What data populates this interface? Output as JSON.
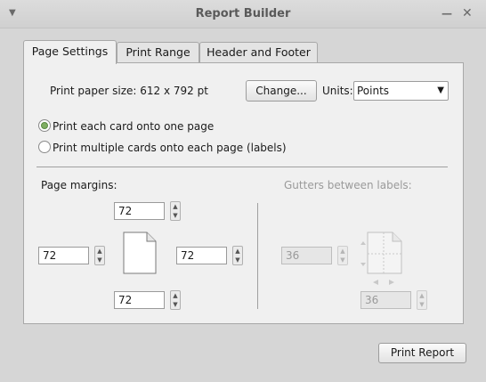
{
  "window": {
    "title": "Report Builder",
    "menu_icon": "chevron-down-icon",
    "min_icon": "minimize-icon",
    "close_icon": "close-icon"
  },
  "tabs": [
    {
      "label": "Page Settings",
      "active": true
    },
    {
      "label": "Print Range",
      "active": false
    },
    {
      "label": "Header and Footer",
      "active": false
    }
  ],
  "page_settings": {
    "paper_size_label": "Print paper size: 612 x 792 pt",
    "change_button": "Change...",
    "units_label": "Units:",
    "units_value": "Points",
    "option_one_page": "Print each card onto one page",
    "option_multiple": "Print multiple cards onto each page (labels)",
    "selected_option": "one-page",
    "margins_heading": "Page margins:",
    "margin_top": "72",
    "margin_left": "72",
    "margin_right": "72",
    "margin_bottom": "72",
    "gutters_heading": "Gutters between labels:",
    "gutter_horizontal": "36",
    "gutter_vertical": "36"
  },
  "footer": {
    "print_button": "Print Report"
  },
  "colors": {
    "radio_selected": "#7fae62",
    "disabled_text": "#9a9a9a"
  }
}
